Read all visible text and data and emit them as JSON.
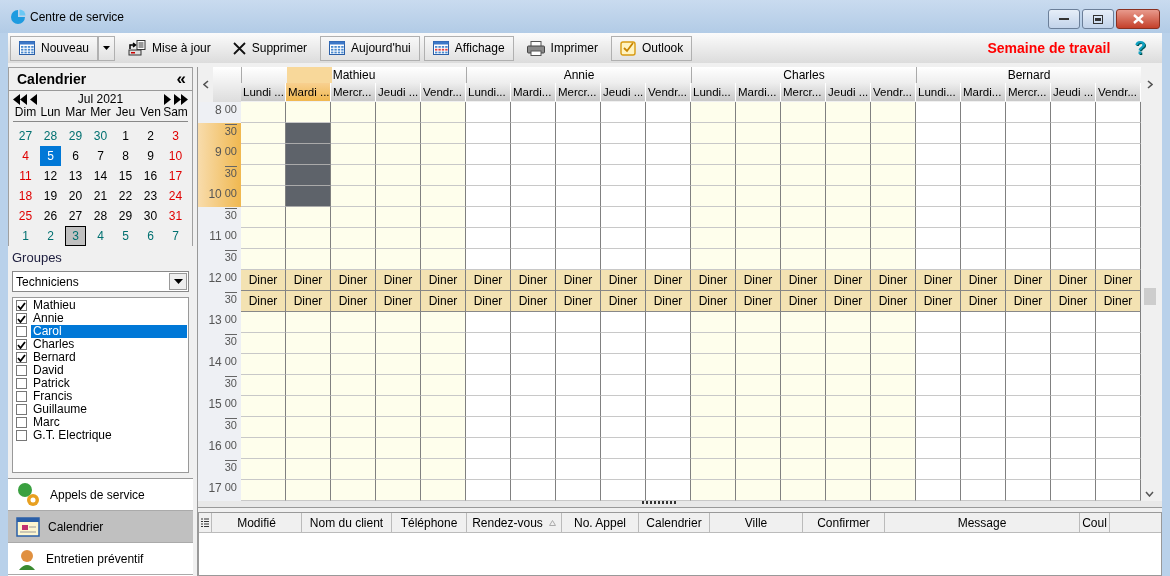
{
  "window": {
    "title": "Centre de service"
  },
  "toolbar": [
    {
      "label": "Nouveau",
      "kind": "split"
    },
    {
      "label": "Mise à jour",
      "kind": "flat"
    },
    {
      "label": "Supprimer",
      "kind": "flat"
    },
    {
      "label": "Aujourd'hui",
      "kind": "raised"
    },
    {
      "label": "Affichage",
      "kind": "raised"
    },
    {
      "label": "Imprimer",
      "kind": "flat"
    },
    {
      "label": "Outlook",
      "kind": "raised"
    }
  ],
  "view_title": "Semaine de travail",
  "help": "?",
  "sidebar": {
    "title": "Calendrier",
    "collapse": "«",
    "month": "Jul 2021",
    "weekdays": [
      "Dim",
      "Lun",
      "Mar",
      "Mer",
      "Jeu",
      "Ven",
      "Sam"
    ],
    "days": [
      {
        "text": "27",
        "kind": "other",
        "selected": false,
        "today": false
      },
      {
        "text": "28",
        "kind": "other",
        "selected": false,
        "today": false
      },
      {
        "text": "29",
        "kind": "other",
        "selected": false,
        "today": false
      },
      {
        "text": "30",
        "kind": "other",
        "selected": false,
        "today": false
      },
      {
        "text": "1",
        "kind": "day",
        "selected": false,
        "today": false
      },
      {
        "text": "2",
        "kind": "day",
        "selected": false,
        "today": false
      },
      {
        "text": "3",
        "kind": "weekend",
        "selected": false,
        "today": false
      },
      {
        "text": "4",
        "kind": "weekend",
        "selected": false,
        "today": false
      },
      {
        "text": "5",
        "kind": "day",
        "selected": true,
        "today": false
      },
      {
        "text": "6",
        "kind": "day",
        "selected": false,
        "today": false
      },
      {
        "text": "7",
        "kind": "day",
        "selected": false,
        "today": false
      },
      {
        "text": "8",
        "kind": "day",
        "selected": false,
        "today": false
      },
      {
        "text": "9",
        "kind": "day",
        "selected": false,
        "today": false
      },
      {
        "text": "10",
        "kind": "weekend",
        "selected": false,
        "today": false
      },
      {
        "text": "11",
        "kind": "weekend",
        "selected": false,
        "today": false
      },
      {
        "text": "12",
        "kind": "day",
        "selected": false,
        "today": false
      },
      {
        "text": "13",
        "kind": "day",
        "selected": false,
        "today": false
      },
      {
        "text": "14",
        "kind": "day",
        "selected": false,
        "today": false
      },
      {
        "text": "15",
        "kind": "day",
        "selected": false,
        "today": false
      },
      {
        "text": "16",
        "kind": "day",
        "selected": false,
        "today": false
      },
      {
        "text": "17",
        "kind": "weekend",
        "selected": false,
        "today": false
      },
      {
        "text": "18",
        "kind": "weekend",
        "selected": false,
        "today": false
      },
      {
        "text": "19",
        "kind": "day",
        "selected": false,
        "today": false
      },
      {
        "text": "20",
        "kind": "day",
        "selected": false,
        "today": false
      },
      {
        "text": "21",
        "kind": "day",
        "selected": false,
        "today": false
      },
      {
        "text": "22",
        "kind": "day",
        "selected": false,
        "today": false
      },
      {
        "text": "23",
        "kind": "day",
        "selected": false,
        "today": false
      },
      {
        "text": "24",
        "kind": "weekend",
        "selected": false,
        "today": false
      },
      {
        "text": "25",
        "kind": "weekend",
        "selected": false,
        "today": false
      },
      {
        "text": "26",
        "kind": "day",
        "selected": false,
        "today": false
      },
      {
        "text": "27",
        "kind": "day",
        "selected": false,
        "today": false
      },
      {
        "text": "28",
        "kind": "day",
        "selected": false,
        "today": false
      },
      {
        "text": "29",
        "kind": "day",
        "selected": false,
        "today": false
      },
      {
        "text": "30",
        "kind": "day",
        "selected": false,
        "today": false
      },
      {
        "text": "31",
        "kind": "weekend",
        "selected": false,
        "today": false
      },
      {
        "text": "1",
        "kind": "other",
        "selected": false,
        "today": false
      },
      {
        "text": "2",
        "kind": "other",
        "selected": false,
        "today": false
      },
      {
        "text": "3",
        "kind": "other",
        "selected": false,
        "today": true
      },
      {
        "text": "4",
        "kind": "other",
        "selected": false,
        "today": false
      },
      {
        "text": "5",
        "kind": "other",
        "selected": false,
        "today": false
      },
      {
        "text": "6",
        "kind": "other",
        "selected": false,
        "today": false
      },
      {
        "text": "7",
        "kind": "other",
        "selected": false,
        "today": false
      }
    ],
    "groups_label": "Groupes",
    "group": "Techniciens",
    "members": [
      {
        "name": "Mathieu",
        "checked": true,
        "selected": false
      },
      {
        "name": "Annie",
        "checked": true,
        "selected": false
      },
      {
        "name": "Carol",
        "checked": false,
        "selected": true
      },
      {
        "name": "Charles",
        "checked": true,
        "selected": false
      },
      {
        "name": "Bernard",
        "checked": true,
        "selected": false
      },
      {
        "name": "David",
        "checked": false,
        "selected": false
      },
      {
        "name": "Patrick",
        "checked": false,
        "selected": false
      },
      {
        "name": "Francis",
        "checked": false,
        "selected": false
      },
      {
        "name": "Guillaume",
        "checked": false,
        "selected": false
      },
      {
        "name": "Marc",
        "checked": false,
        "selected": false
      },
      {
        "name": "G.T. Electrique",
        "checked": false,
        "selected": false
      }
    ],
    "nav": [
      {
        "label": "Appels de service",
        "selected": false
      },
      {
        "label": "Calendrier",
        "selected": true
      },
      {
        "label": "Entretien préventif",
        "selected": false
      }
    ]
  },
  "schedule": {
    "people": [
      {
        "name": "Mathieu",
        "days": [
          {
            "label": "Lundi ...",
            "selected": false
          },
          {
            "label": "Mardi ...",
            "selected": true
          },
          {
            "label": "Mercr...",
            "selected": false
          },
          {
            "label": "Jeudi ...",
            "selected": false
          },
          {
            "label": "Vendr...",
            "selected": false
          }
        ]
      },
      {
        "name": "Annie",
        "days": [
          {
            "label": "Lundi...",
            "selected": false
          },
          {
            "label": "Mardi...",
            "selected": false
          },
          {
            "label": "Mercr...",
            "selected": false
          },
          {
            "label": "Jeudi ...",
            "selected": false
          },
          {
            "label": "Vendr...",
            "selected": false
          }
        ]
      },
      {
        "name": "Charles",
        "days": [
          {
            "label": "Lundi...",
            "selected": false
          },
          {
            "label": "Mardi...",
            "selected": false
          },
          {
            "label": "Mercr...",
            "selected": false
          },
          {
            "label": "Jeudi ...",
            "selected": false
          },
          {
            "label": "Vendr...",
            "selected": false
          }
        ]
      },
      {
        "name": "Bernard",
        "days": [
          {
            "label": "Lundi...",
            "selected": false
          },
          {
            "label": "Mardi...",
            "selected": false
          },
          {
            "label": "Mercr...",
            "selected": false
          },
          {
            "label": "Jeudi ...",
            "selected": false
          },
          {
            "label": "Vendr...",
            "selected": false
          }
        ]
      }
    ],
    "slots": [
      {
        "hour": "8",
        "minute": "00",
        "selected": false
      },
      {
        "minute": "30",
        "selected": true
      },
      {
        "hour": "9",
        "minute": "00",
        "selected": true
      },
      {
        "minute": "30",
        "selected": true
      },
      {
        "hour": "10",
        "minute": "00",
        "selected": true
      },
      {
        "minute": "30",
        "selected": false
      },
      {
        "hour": "11",
        "minute": "00",
        "selected": false
      },
      {
        "minute": "30",
        "selected": false
      },
      {
        "hour": "12",
        "minute": "00",
        "selected": false,
        "cells": [
          "Diner",
          "Diner",
          "Diner",
          "Diner",
          "Diner",
          "Diner",
          "Diner",
          "Diner",
          "Diner",
          "Diner",
          "Diner",
          "Diner",
          "Diner",
          "Diner",
          "Diner",
          "Diner",
          "Diner",
          "Diner",
          "Diner",
          "Diner"
        ]
      },
      {
        "minute": "30",
        "selected": false,
        "cells": [
          "Diner",
          "Diner",
          "Diner",
          "Diner",
          "Diner",
          "Diner",
          "Diner",
          "Diner",
          "Diner",
          "Diner",
          "Diner",
          "Diner",
          "Diner",
          "Diner",
          "Diner",
          "Diner",
          "Diner",
          "Diner",
          "Diner",
          "Diner"
        ]
      },
      {
        "hour": "13",
        "minute": "00",
        "selected": false
      },
      {
        "minute": "30",
        "selected": false
      },
      {
        "hour": "14",
        "minute": "00",
        "selected": false
      },
      {
        "minute": "30",
        "selected": false
      },
      {
        "hour": "15",
        "minute": "00",
        "selected": false
      },
      {
        "minute": "30",
        "selected": false
      },
      {
        "hour": "16",
        "minute": "00",
        "selected": false
      },
      {
        "minute": "30",
        "selected": false
      },
      {
        "hour": "17",
        "minute": "00",
        "selected": false
      }
    ]
  },
  "calls_table": {
    "columns": [
      {
        "label": "Modifié",
        "sorted": false
      },
      {
        "label": "Nom du client",
        "sorted": false
      },
      {
        "label": "Téléphone",
        "sorted": false
      },
      {
        "label": "Rendez-vous",
        "sorted": true
      },
      {
        "label": "No. Appel",
        "sorted": false
      },
      {
        "label": "Calendrier",
        "sorted": false
      },
      {
        "label": "Ville",
        "sorted": false
      },
      {
        "label": "Confirmer",
        "sorted": false
      },
      {
        "label": "Message",
        "sorted": false
      },
      {
        "label": "Coul",
        "sorted": false
      }
    ]
  }
}
